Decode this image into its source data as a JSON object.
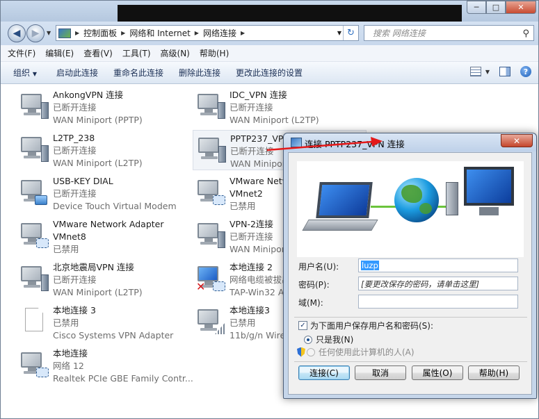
{
  "window": {
    "controls": {
      "minimize": "─",
      "maximize": "□",
      "close": "✕"
    }
  },
  "nav": {
    "back_glyph": "◀",
    "forward_glyph": "▶",
    "breadcrumb": [
      "控制面板",
      "网络和 Internet",
      "网络连接"
    ],
    "search_placeholder": "搜索 网络连接"
  },
  "menu": [
    "文件(F)",
    "编辑(E)",
    "查看(V)",
    "工具(T)",
    "高级(N)",
    "帮助(H)"
  ],
  "toolbar": {
    "organize": "组织",
    "start": "启动此连接",
    "rename": "重命名此连接",
    "delete": "删除此连接",
    "change": "更改此连接的设置"
  },
  "connections": [
    {
      "name": "AnkongVPN 连接",
      "status": "已断开连接",
      "device": "WAN Miniport (PPTP)",
      "icon": "vpn-icon"
    },
    {
      "name": "IDC_VPN 连接",
      "status": "已断开连接",
      "device": "WAN Miniport (L2TP)",
      "icon": "vpn-icon"
    },
    {
      "name": "L2TP_238",
      "status": "已断开连接",
      "device": "WAN Miniport (L2TP)",
      "icon": "vpn-icon"
    },
    {
      "name": "PPTP237_VPN 连接",
      "status": "已断开连接",
      "device": "WAN Miniport (PPTP)",
      "icon": "vpn-icon"
    },
    {
      "name": "USB-KEY DIAL",
      "status": "已断开连接",
      "device": "Device Touch Virtual Modem",
      "icon": "modem-icon"
    },
    {
      "name": "VMware Network Adapter VMnet2",
      "status": "已禁用",
      "device": "",
      "icon": "ethernet-icon"
    },
    {
      "name": "VMware Network Adapter",
      "status": "VMnet8",
      "device": "已禁用",
      "icon": "ethernet-icon"
    },
    {
      "name": "VPN-2连接",
      "status": "已断开连接",
      "device": "WAN Miniport (PPTP)",
      "icon": "vpn-icon"
    },
    {
      "name": "北京地震局VPN 连接",
      "status": "已断开连接",
      "device": "WAN Miniport (L2TP)",
      "icon": "vpn-icon"
    },
    {
      "name": "本地连接 2",
      "status": "网络电缆被拔出",
      "device": "TAP-Win32 Adapter V9",
      "icon": "ethernet-unplugged-icon"
    },
    {
      "name": "本地连接 3",
      "status": "已禁用",
      "device": "Cisco Systems VPN Adapter",
      "icon": "document-icon"
    },
    {
      "name": "本地连接3",
      "status": "已禁用",
      "device": "11b/g/n  Wireless LAN",
      "icon": "wireless-icon"
    },
    {
      "name": "本地连接",
      "status": "网络  12",
      "device": "Realtek PCIe GBE Family Contr...",
      "icon": "ethernet-icon"
    }
  ],
  "dialog": {
    "title": "连接 PPTP237_VPN 连接",
    "close": "✕",
    "username_label": "用户名(U):",
    "username_value": "luzp",
    "password_label": "密码(P):",
    "password_value": "[要更改保存的密码，请单击这里]",
    "domain_label": "域(M):",
    "domain_value": "",
    "save_label": "为下面用户保存用户名和密码(S):",
    "save_checked": true,
    "only_me": "只是我(N)",
    "anyone": "任何使用此计算机的人(A)",
    "buttons": {
      "connect": "连接(C)",
      "cancel": "取消",
      "properties": "属性(O)",
      "help": "帮助(H)"
    }
  }
}
